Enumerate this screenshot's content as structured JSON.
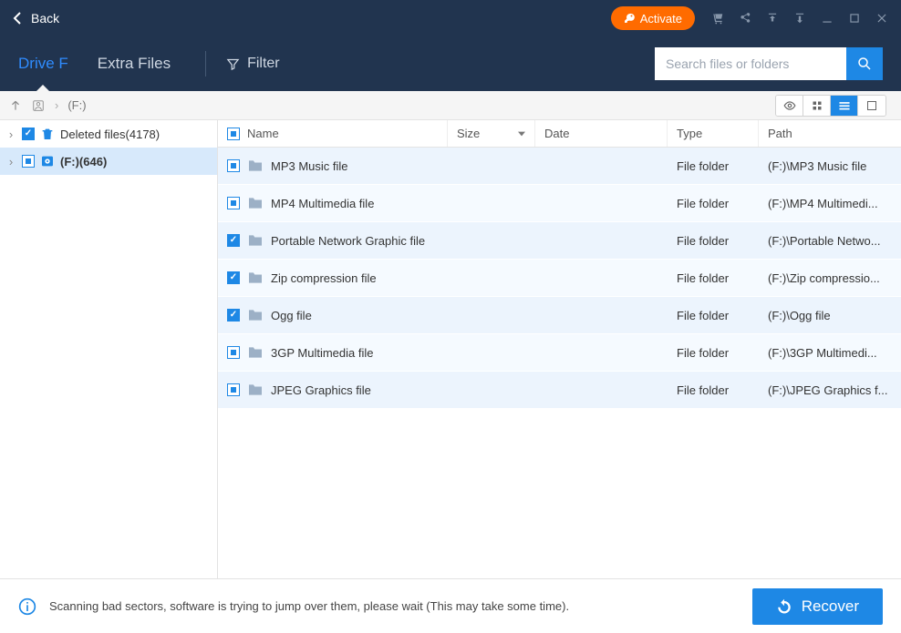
{
  "titlebar": {
    "back_label": "Back",
    "activate_label": "Activate"
  },
  "tabs": {
    "drive_label": "Drive F",
    "extra_label": "Extra Files",
    "filter_label": "Filter"
  },
  "search": {
    "placeholder": "Search files or folders"
  },
  "breadcrumb": {
    "location": "(F:)"
  },
  "tree": {
    "items": [
      {
        "label": "Deleted files(4178)",
        "checked": "checked",
        "icon": "trash",
        "selected": false
      },
      {
        "label": "(F:)(646)",
        "checked": "partial",
        "icon": "disk",
        "selected": true
      }
    ]
  },
  "columns": {
    "name": "Name",
    "size": "Size",
    "date": "Date",
    "type": "Type",
    "path": "Path"
  },
  "rows": [
    {
      "check": "partial",
      "name": "MP3 Music file",
      "size": "",
      "date": "",
      "type": "File folder",
      "path": "(F:)\\MP3 Music file"
    },
    {
      "check": "partial",
      "name": "MP4 Multimedia file",
      "size": "",
      "date": "",
      "type": "File folder",
      "path": "(F:)\\MP4 Multimedi..."
    },
    {
      "check": "checked",
      "name": "Portable Network Graphic file",
      "size": "",
      "date": "",
      "type": "File folder",
      "path": "(F:)\\Portable Netwo..."
    },
    {
      "check": "checked",
      "name": "Zip compression file",
      "size": "",
      "date": "",
      "type": "File folder",
      "path": "(F:)\\Zip compressio..."
    },
    {
      "check": "checked",
      "name": "Ogg file",
      "size": "",
      "date": "",
      "type": "File folder",
      "path": "(F:)\\Ogg file"
    },
    {
      "check": "partial",
      "name": "3GP Multimedia file",
      "size": "",
      "date": "",
      "type": "File folder",
      "path": "(F:)\\3GP Multimedi..."
    },
    {
      "check": "partial",
      "name": "JPEG Graphics file",
      "size": "",
      "date": "",
      "type": "File folder",
      "path": "(F:)\\JPEG Graphics f..."
    }
  ],
  "footer": {
    "message": "Scanning bad sectors, software is trying to jump over them, please wait (This may take some time).",
    "recover_label": "Recover"
  }
}
